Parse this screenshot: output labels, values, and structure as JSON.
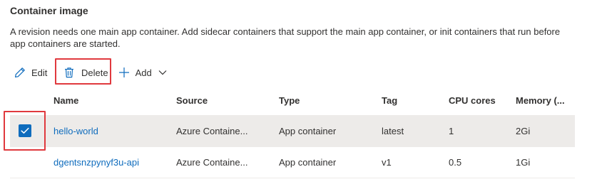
{
  "section": {
    "title": "Container image",
    "description": "A revision needs one main app container. Add sidecar containers that support the main app container, or init containers that run before app containers are started."
  },
  "toolbar": {
    "edit_label": "Edit",
    "delete_label": "Delete",
    "add_label": "Add"
  },
  "table": {
    "columns": [
      "Name",
      "Source",
      "Type",
      "Tag",
      "CPU cores",
      "Memory (..."
    ],
    "rows": [
      {
        "name": "hello-world",
        "source": "Azure Containe...",
        "type": "App container",
        "tag": "latest",
        "cpu": "1",
        "memory": "2Gi",
        "selected": true
      },
      {
        "name": "dgentsnzpynyf3u-api",
        "source": "Azure Containe...",
        "type": "App container",
        "tag": "v1",
        "cpu": "0.5",
        "memory": "1Gi",
        "selected": false
      }
    ]
  },
  "colors": {
    "accent": "#0f6cbd",
    "highlight": "#e0393e",
    "selected_row": "#edebe9"
  },
  "icons": {
    "edit": "pencil-icon",
    "delete": "trash-icon",
    "add": "plus-icon",
    "dropdown": "chevron-down-icon",
    "check": "checkmark-icon"
  }
}
